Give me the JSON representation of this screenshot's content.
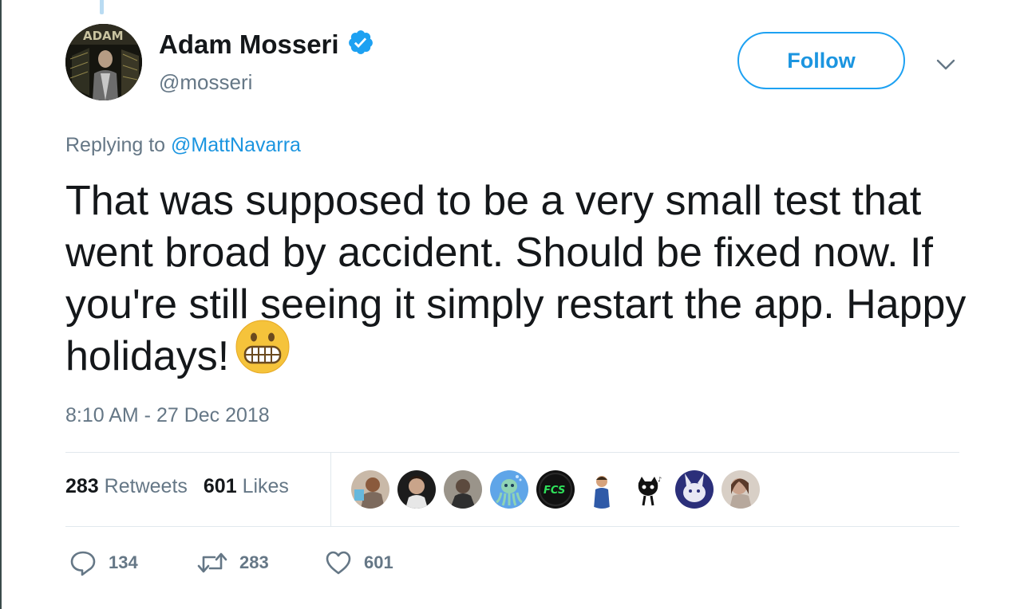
{
  "author": {
    "name": "Adam Mosseri",
    "handle": "@mosseri",
    "verified": true
  },
  "header": {
    "follow_label": "Follow"
  },
  "reply": {
    "prefix": "Replying to",
    "target": "@MattNavarra"
  },
  "tweet": {
    "text": "That was supposed to be a very small test that went broad by accident. Should be fixed now. If you're still seeing it simply restart the app. Happy holidays!",
    "emoji": "grimacing-face-emoji",
    "timestamp": "8:10 AM - 27 Dec 2018"
  },
  "stats": {
    "retweets_count": "283",
    "retweets_label": "Retweets",
    "likes_count": "601",
    "likes_label": "Likes"
  },
  "actions": {
    "reply_count": "134",
    "retweet_count": "283",
    "like_count": "601"
  },
  "colors": {
    "accent": "#1da1f2",
    "link": "#1b95e0",
    "secondary_text": "#657786",
    "primary_text": "#14171a",
    "divider": "#e1e8ed"
  }
}
